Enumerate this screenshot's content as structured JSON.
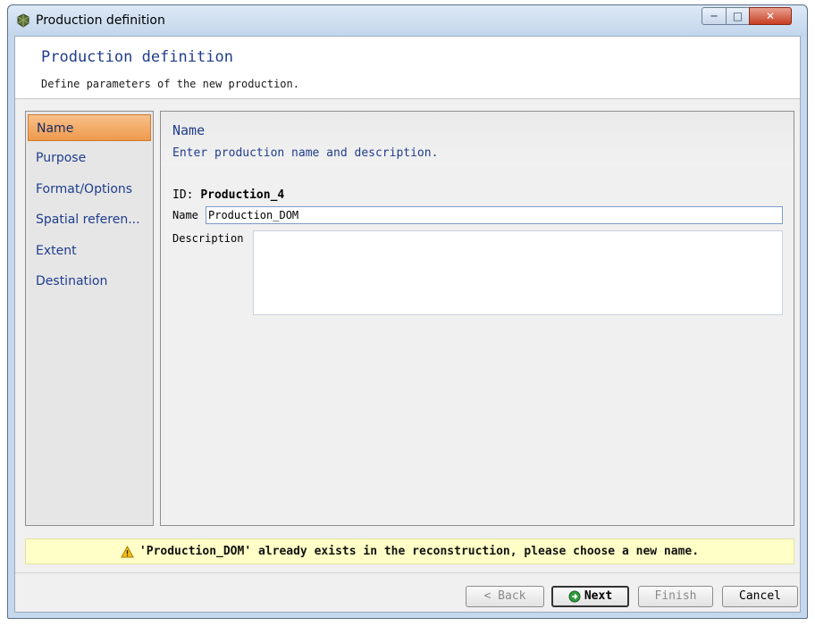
{
  "window": {
    "title": "Production definition",
    "controls": {
      "minimize": "─",
      "maximize": "□",
      "close": "✕"
    }
  },
  "header": {
    "title": "Production definition",
    "subtitle": "Define parameters of the new production."
  },
  "nav": {
    "items": [
      {
        "label": "Name",
        "selected": true
      },
      {
        "label": "Purpose",
        "selected": false
      },
      {
        "label": "Format/Options",
        "selected": false
      },
      {
        "label": "Spatial referen...",
        "selected": false
      },
      {
        "label": "Extent",
        "selected": false
      },
      {
        "label": "Destination",
        "selected": false
      }
    ]
  },
  "panel": {
    "title": "Name",
    "subtitle": "Enter production name and description.",
    "id_label": "ID:",
    "id_value": "Production_4",
    "name_label": "Name",
    "name_value": "Production_DOM",
    "description_label": "Description",
    "description_value": ""
  },
  "message": {
    "icon": "warning-icon",
    "text": "'Production_DOM' already exists in the reconstruction, please choose a new name."
  },
  "footer": {
    "back_label": "< Back",
    "next_label": "Next",
    "finish_label": "Finish",
    "cancel_label": "Cancel"
  },
  "colors": {
    "accent": "#1f3d8c",
    "selected_nav": "#ee9a4e",
    "warning_bg": "#ffffc7"
  }
}
